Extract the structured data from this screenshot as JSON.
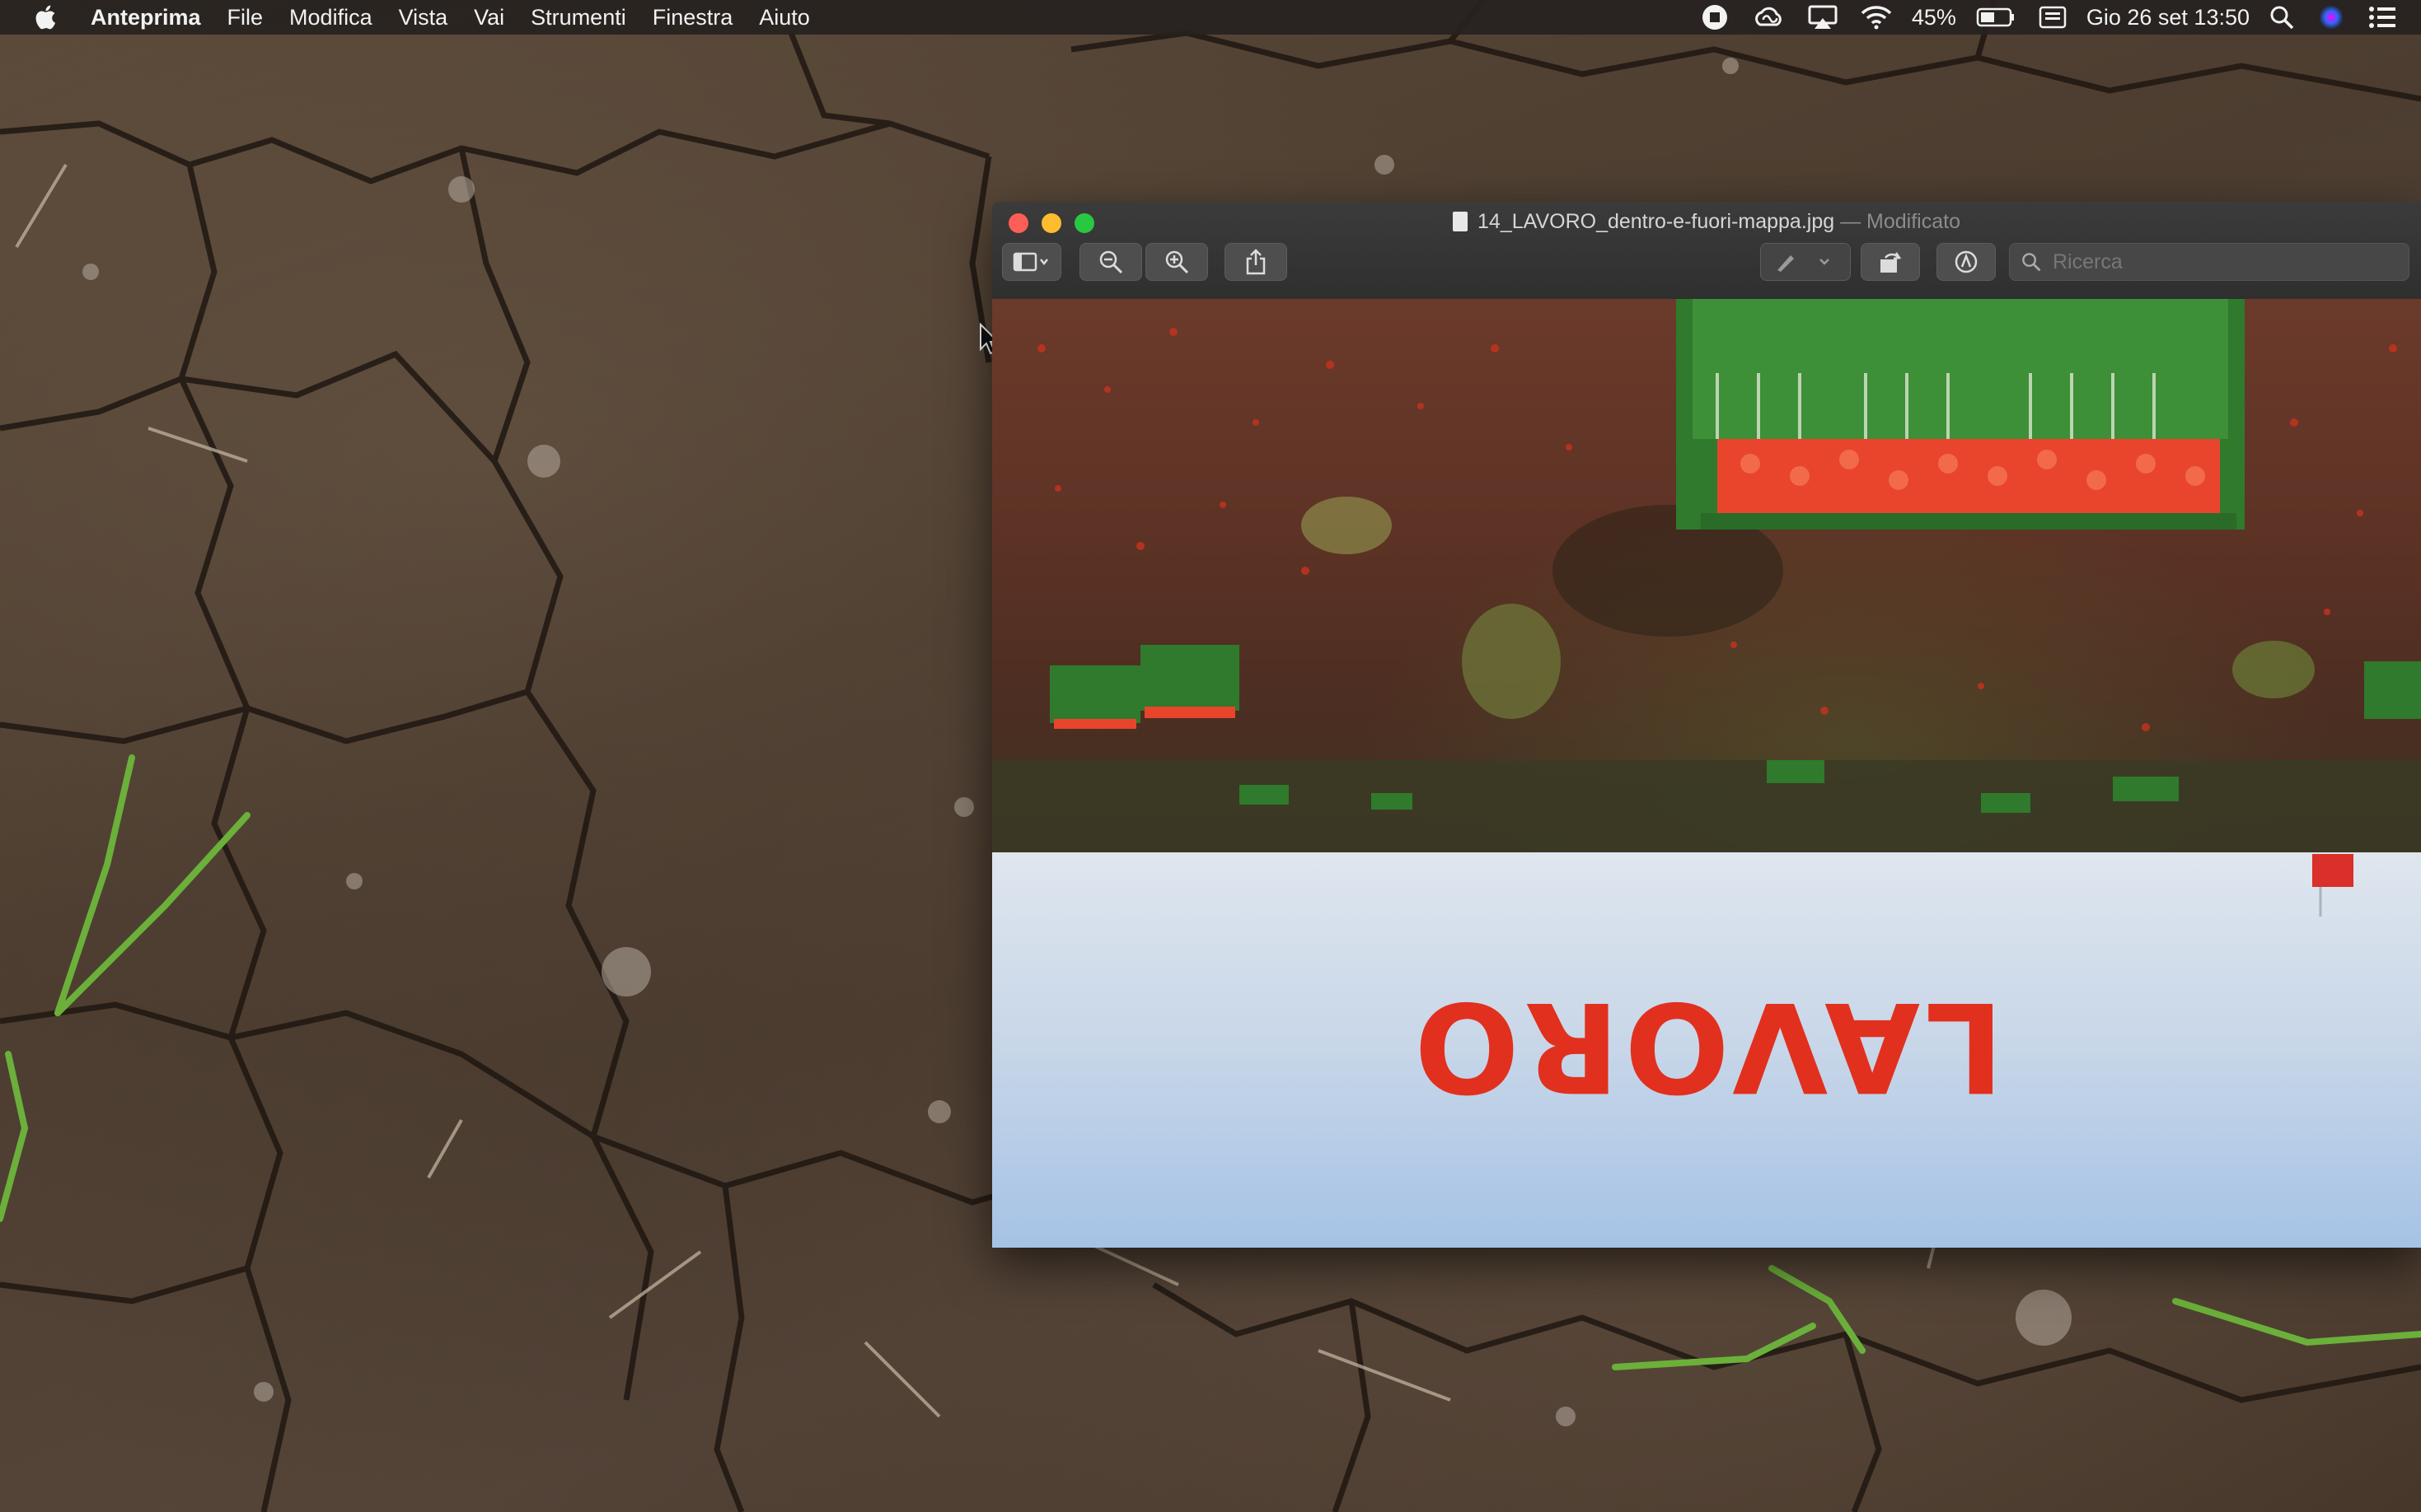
{
  "menubar": {
    "apple_icon": "apple-logo-icon",
    "app_name": "Anteprima",
    "menus": [
      "File",
      "Modifica",
      "Vista",
      "Vai",
      "Strumenti",
      "Finestra",
      "Aiuto"
    ],
    "status": {
      "battery_percent": "45%",
      "datetime": "Gio 26 set  13:50"
    }
  },
  "window": {
    "filename": "14_LAVORO_dentro-e-fuori-mappa.jpg",
    "separator": " — ",
    "state": "Modificato",
    "search_placeholder": "Ricerca"
  },
  "image": {
    "overlay_text": "LAVORO",
    "colors": {
      "text": "#e2301f",
      "sky": "#c7d6e8",
      "soil": "#5e3325",
      "crate": "#2f7a2c",
      "tomato": "#e8452c"
    }
  }
}
